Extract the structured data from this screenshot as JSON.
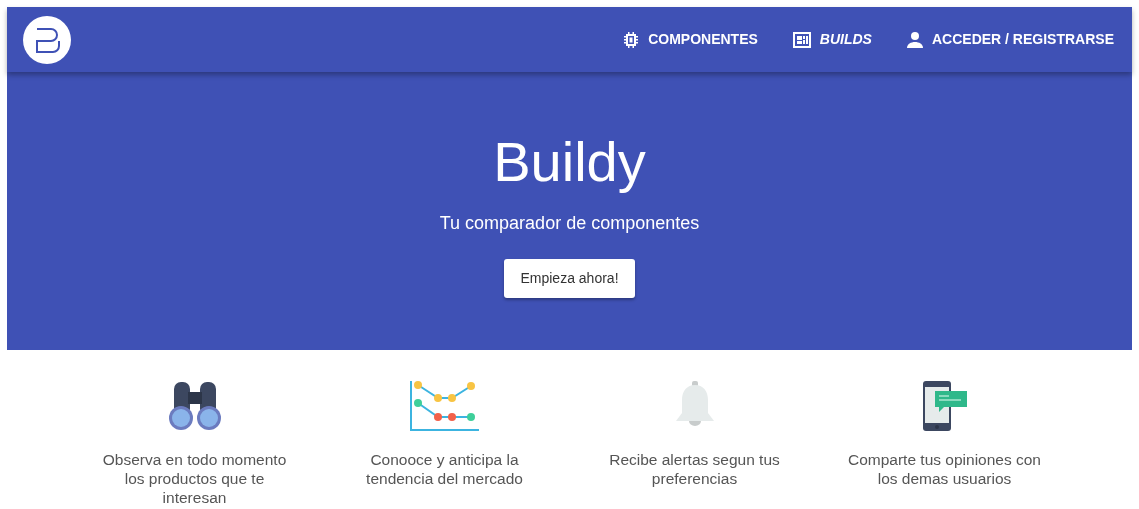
{
  "navbar": {
    "nav_items": [
      {
        "kind": "chip",
        "label": "COMPONENTES",
        "selected": false
      },
      {
        "kind": "grid",
        "label": "BUILDS",
        "selected": true
      },
      {
        "kind": "person",
        "label": "ACCEDER / REGISTRARSE",
        "selected": false
      }
    ]
  },
  "hero": {
    "title": "Buildy",
    "subtitle": "Tu comparador de componentes",
    "button": "Empieza ahora!"
  },
  "features": [
    {
      "kind": "binoculars",
      "text": "Observa en todo momento los productos que te interesan"
    },
    {
      "kind": "chart",
      "text": "Conooce y anticipa la tendencia del mercado"
    },
    {
      "kind": "bell",
      "text": "Recibe alertas segun tus preferencias"
    },
    {
      "kind": "phone",
      "text": "Comparte tus opiniones con los demas usuarios"
    }
  ]
}
